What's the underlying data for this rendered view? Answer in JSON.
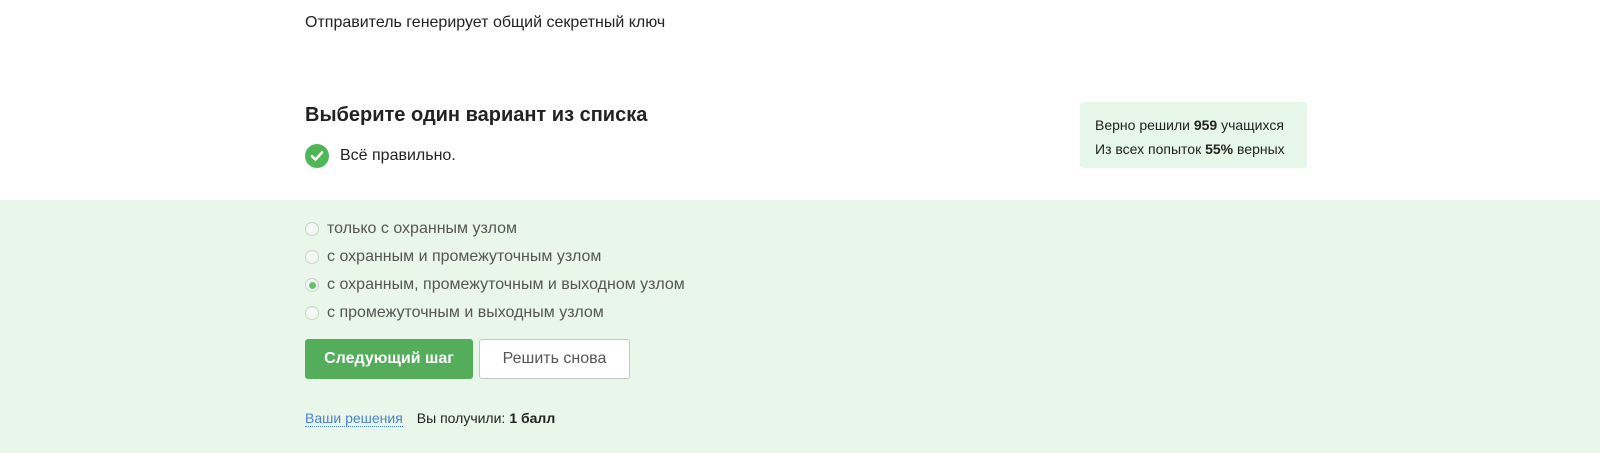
{
  "previous_answer_text": "Отправитель генерирует общий секретный ключ",
  "question": {
    "heading": "Выберите один вариант из списка",
    "result_text": "Всё правильно."
  },
  "stats": {
    "solved_prefix": "Верно решили",
    "solved_count": "959",
    "solved_suffix": "учащихся",
    "attempts_prefix": "Из всех попыток",
    "attempts_percent": "55%",
    "attempts_suffix": "верных"
  },
  "options": [
    {
      "label": "только с охранным узлом",
      "selected": false
    },
    {
      "label": "с охранным и промежуточным узлом",
      "selected": false
    },
    {
      "label": "с охранным, промежуточным и выходном узлом",
      "selected": true
    },
    {
      "label": "с промежуточным и выходным узлом",
      "selected": false
    }
  ],
  "buttons": {
    "next_step": "Следующий шаг",
    "solve_again": "Решить снова"
  },
  "footer": {
    "solutions_link": "Ваши решения",
    "score_label": "Вы получили:",
    "score_value": "1 балл"
  },
  "colors": {
    "accent_green": "#54ad5a",
    "check_green": "#4fb658",
    "success_background": "#e8f7e9",
    "link_blue": "#4a82d8"
  }
}
